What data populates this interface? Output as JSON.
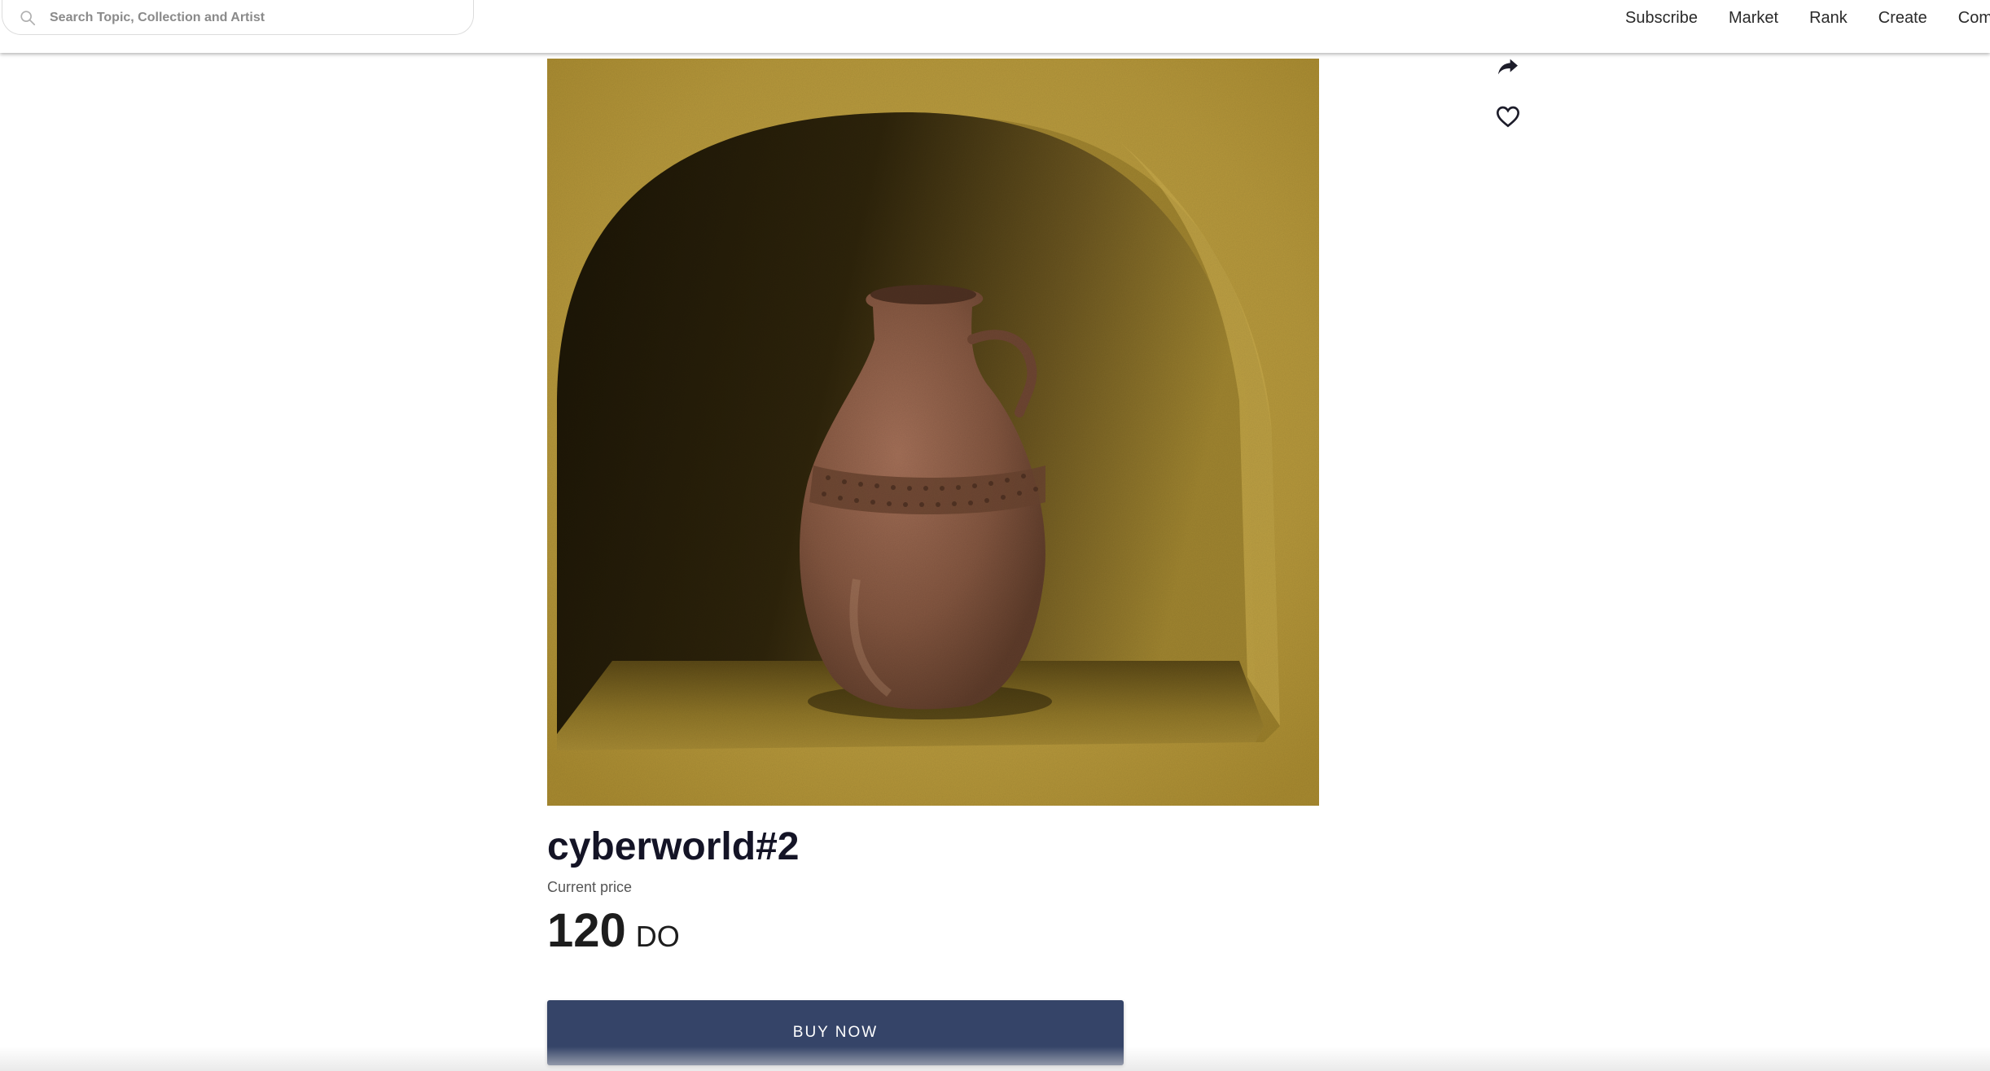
{
  "header": {
    "search": {
      "placeholder": "Search Topic, Collection and Artist",
      "value": "",
      "icon": "search-icon"
    },
    "nav": [
      {
        "label": "Subscribe"
      },
      {
        "label": "Market"
      },
      {
        "label": "Rank"
      },
      {
        "label": "Create"
      },
      {
        "label": "Community"
      }
    ]
  },
  "item": {
    "image": {
      "subject": "clay-vase-in-niche",
      "colors": {
        "wall": "#b89a3a",
        "shadow": "#2a2008",
        "vase": "#8a5a40"
      }
    },
    "actions": [
      {
        "icon": "share-icon"
      },
      {
        "icon": "heart-icon"
      }
    ],
    "title": "cyberworld#2",
    "price_label": "Current price",
    "price_value": "120",
    "price_unit": "DO",
    "buy_label": "BUY NOW"
  },
  "colors": {
    "accent": "#354468",
    "text_dark": "#141426"
  }
}
